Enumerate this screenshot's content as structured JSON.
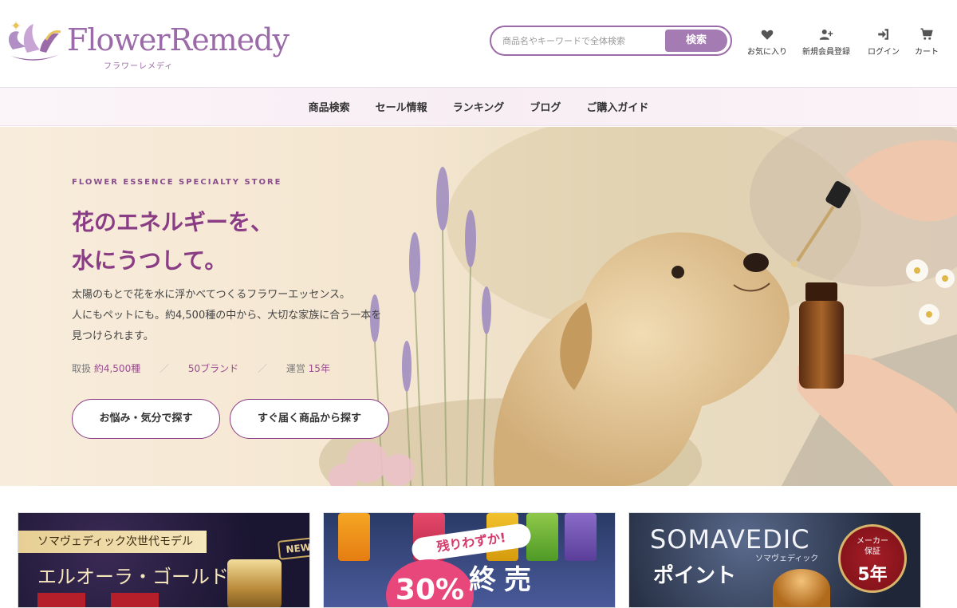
{
  "brand": {
    "wordmark": "FlowerRemedy",
    "kana": "フラワーレメディ"
  },
  "search": {
    "placeholder": "商品名やキーワードで全体検索",
    "button": "検索"
  },
  "header_icons": [
    {
      "icon": "heart-icon",
      "label": "お気に入り"
    },
    {
      "icon": "user-plus-icon",
      "label": "新規会員登録"
    },
    {
      "icon": "login-icon",
      "label": "ログイン"
    },
    {
      "icon": "cart-icon",
      "label": "カート"
    }
  ],
  "nav": [
    "商品検索",
    "セール情報",
    "ランキング",
    "ブログ",
    "ご購入ガイド"
  ],
  "hero": {
    "eyebrow": "FLOWER ESSENCE SPECIALTY STORE",
    "headline_1": "花のエネルギーを、",
    "headline_2": "水にうつして。",
    "lead_1": "太陽のもとで花を水に浮かべてつくるフラワーエッセンス。",
    "lead_2": "人にもペットにも。約4,500種の中から、大切な家族に合う一本を",
    "lead_3": "見つけられます。",
    "stats": {
      "s1_label": "取扱",
      "s1_value": "約4,500種",
      "sep": "／",
      "s2_value": "50ブランド",
      "s3_label": "運営",
      "s3_value": "15年"
    },
    "cta_1": "お悩み・気分で探す",
    "cta_2": "すぐ届く商品から探す"
  },
  "banners": {
    "b1": {
      "tag": "ソマヴェディック次世代モデル",
      "title": "エルオーラ・ゴールド",
      "badge": "NEW!"
    },
    "b2": {
      "badge": "残りわずか!",
      "percent": "30%",
      "end": "終売"
    },
    "b3": {
      "brand": "SOMAVEDIC",
      "brand_kana": "ソマヴェディック",
      "point": "ポイント",
      "seal_1": "メーカー",
      "seal_2": "保証",
      "seal_3": "5年"
    }
  },
  "colors": {
    "accent": "#9b6aa8",
    "headline": "#8a3d85"
  }
}
